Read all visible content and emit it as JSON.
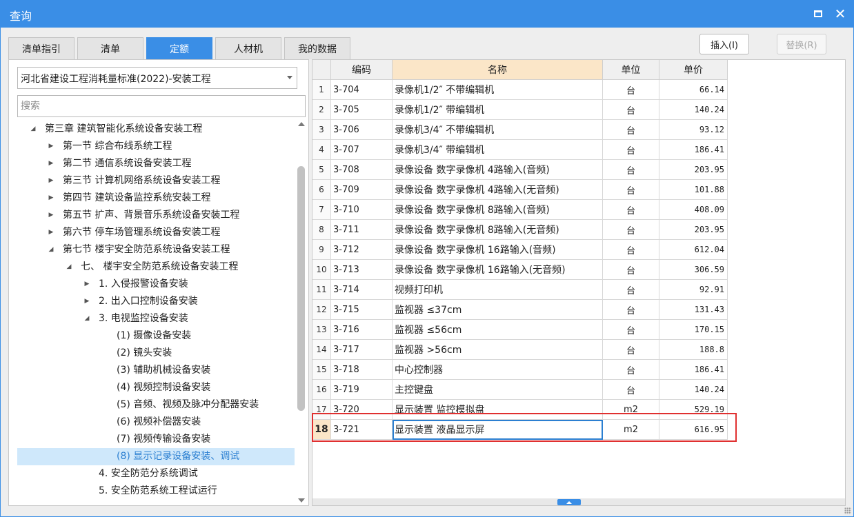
{
  "window": {
    "title": "查询"
  },
  "tabs": [
    {
      "label": "清单指引",
      "active": false
    },
    {
      "label": "清单",
      "active": false
    },
    {
      "label": "定额",
      "active": true
    },
    {
      "label": "人材机",
      "active": false
    },
    {
      "label": "我的数据",
      "active": false
    }
  ],
  "buttons": {
    "insert": "插入(I)",
    "replace": "替换(R)"
  },
  "left": {
    "standard": "河北省建设工程消耗量标准(2022)-安装工程",
    "search_placeholder": "搜索",
    "tree": [
      {
        "label": "第三章 建筑智能化系统设备安装工程",
        "level": 0,
        "arrow": "down"
      },
      {
        "label": "第一节 综合布线系统工程",
        "level": 1,
        "arrow": "right"
      },
      {
        "label": "第二节 通信系统设备安装工程",
        "level": 1,
        "arrow": "right"
      },
      {
        "label": "第三节 计算机网络系统设备安装工程",
        "level": 1,
        "arrow": "right"
      },
      {
        "label": "第四节 建筑设备监控系统安装工程",
        "level": 1,
        "arrow": "right"
      },
      {
        "label": "第五节 扩声、背景音乐系统设备安装工程",
        "level": 1,
        "arrow": "right"
      },
      {
        "label": "第六节 停车场管理系统设备安装工程",
        "level": 1,
        "arrow": "right"
      },
      {
        "label": "第七节 楼宇安全防范系统设备安装工程",
        "level": 1,
        "arrow": "down"
      },
      {
        "label": "七、 楼宇安全防范系统设备安装工程",
        "level": 2,
        "arrow": "down"
      },
      {
        "label": "1. 入侵报警设备安装",
        "level": 3,
        "arrow": "right"
      },
      {
        "label": "2. 出入口控制设备安装",
        "level": 3,
        "arrow": "right"
      },
      {
        "label": "3. 电视监控设备安装",
        "level": 3,
        "arrow": "down"
      },
      {
        "label": "(1) 摄像设备安装",
        "level": 4,
        "arrow": ""
      },
      {
        "label": "(2) 镜头安装",
        "level": 4,
        "arrow": ""
      },
      {
        "label": "(3) 辅助机械设备安装",
        "level": 4,
        "arrow": ""
      },
      {
        "label": "(4) 视频控制设备安装",
        "level": 4,
        "arrow": ""
      },
      {
        "label": "(5) 音频、视频及脉冲分配器安装",
        "level": 4,
        "arrow": ""
      },
      {
        "label": "(6) 视频补偿器安装",
        "level": 4,
        "arrow": ""
      },
      {
        "label": "(7) 视频传输设备安装",
        "level": 4,
        "arrow": ""
      },
      {
        "label": "(8) 显示记录设备安装、调试",
        "level": 4,
        "arrow": "",
        "selected": true
      },
      {
        "label": "4. 安全防范分系统调试",
        "level": 3,
        "arrow": ""
      },
      {
        "label": "5. 安全防范系统工程试运行",
        "level": 3,
        "arrow": ""
      }
    ]
  },
  "grid": {
    "headers": {
      "code": "编码",
      "name": "名称",
      "unit": "单位",
      "price": "单价"
    },
    "rows": [
      {
        "num": "1",
        "code": "3-704",
        "name": "录像机1/2″ 不带编辑机",
        "unit": "台",
        "price": "66.14"
      },
      {
        "num": "2",
        "code": "3-705",
        "name": "录像机1/2″ 带编辑机",
        "unit": "台",
        "price": "140.24"
      },
      {
        "num": "3",
        "code": "3-706",
        "name": "录像机3/4″ 不带编辑机",
        "unit": "台",
        "price": "93.12"
      },
      {
        "num": "4",
        "code": "3-707",
        "name": "录像机3/4″ 带编辑机",
        "unit": "台",
        "price": "186.41"
      },
      {
        "num": "5",
        "code": "3-708",
        "name": "录像设备 数字录像机 4路输入(音频)",
        "unit": "台",
        "price": "203.95"
      },
      {
        "num": "6",
        "code": "3-709",
        "name": "录像设备 数字录像机 4路输入(无音频)",
        "unit": "台",
        "price": "101.88"
      },
      {
        "num": "7",
        "code": "3-710",
        "name": "录像设备 数字录像机 8路输入(音频)",
        "unit": "台",
        "price": "408.09"
      },
      {
        "num": "8",
        "code": "3-711",
        "name": "录像设备 数字录像机 8路输入(无音频)",
        "unit": "台",
        "price": "203.95"
      },
      {
        "num": "9",
        "code": "3-712",
        "name": "录像设备 数字录像机 16路输入(音频)",
        "unit": "台",
        "price": "612.04"
      },
      {
        "num": "10",
        "code": "3-713",
        "name": "录像设备 数字录像机 16路输入(无音频)",
        "unit": "台",
        "price": "306.59"
      },
      {
        "num": "11",
        "code": "3-714",
        "name": "视频打印机",
        "unit": "台",
        "price": "92.91"
      },
      {
        "num": "12",
        "code": "3-715",
        "name": "监视器 ≤37cm",
        "unit": "台",
        "price": "131.43"
      },
      {
        "num": "13",
        "code": "3-716",
        "name": "监视器 ≤56cm",
        "unit": "台",
        "price": "170.15"
      },
      {
        "num": "14",
        "code": "3-717",
        "name": "监视器 >56cm",
        "unit": "台",
        "price": "188.8"
      },
      {
        "num": "15",
        "code": "3-718",
        "name": "中心控制器",
        "unit": "台",
        "price": "186.41"
      },
      {
        "num": "16",
        "code": "3-719",
        "name": "主控键盘",
        "unit": "台",
        "price": "140.24"
      },
      {
        "num": "17",
        "code": "3-720",
        "name": "显示装置 监控模拟盘",
        "unit": "m2",
        "price": "529.19"
      },
      {
        "num": "18",
        "code": "3-721",
        "name": "显示装置 液晶显示屏",
        "unit": "m2",
        "price": "616.95",
        "current": true
      }
    ]
  }
}
